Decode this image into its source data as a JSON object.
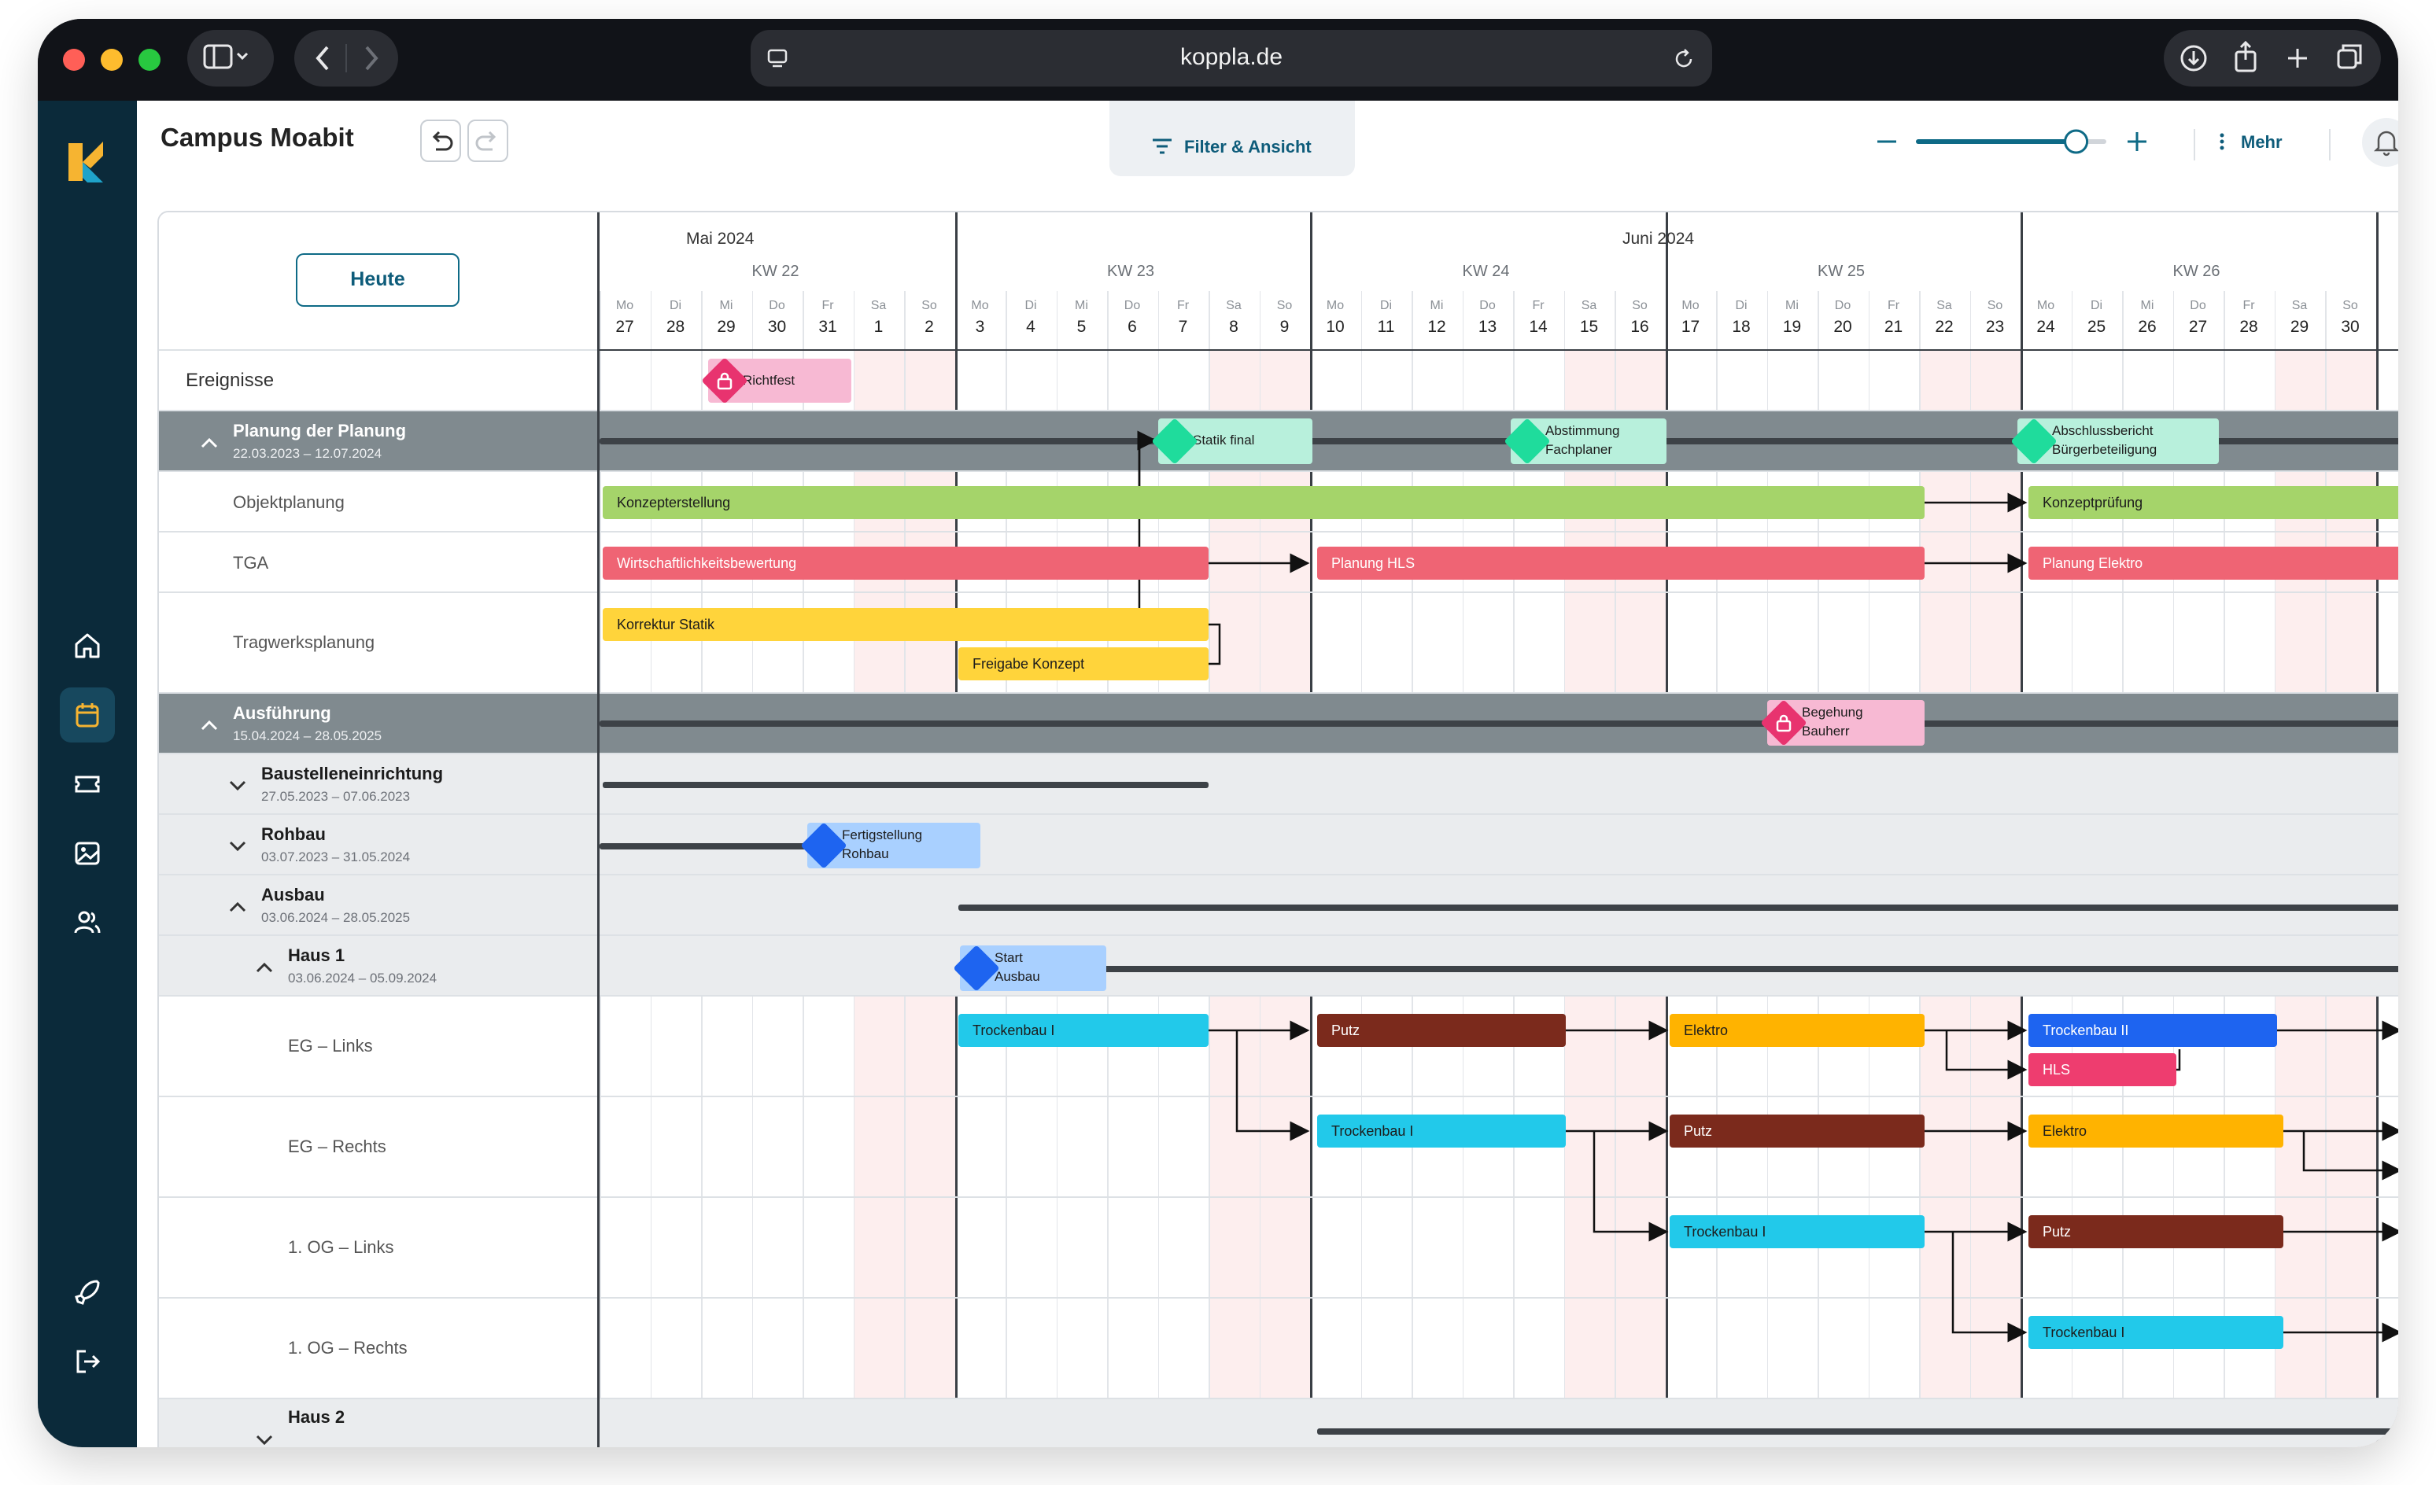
{
  "browser": {
    "url": "koppla.de"
  },
  "header": {
    "title": "Campus Moabit",
    "filter_label": "Filter & Ansicht",
    "more_label": "Mehr"
  },
  "board": {
    "today_label": "Heute",
    "months": [
      "Mai 2024",
      "Juni 2024"
    ],
    "weeks": [
      "KW 22",
      "KW 23",
      "KW 24",
      "KW 25",
      "KW 26"
    ],
    "days": [
      {
        "dow": "Mo",
        "num": "27"
      },
      {
        "dow": "Di",
        "num": "28"
      },
      {
        "dow": "Mi",
        "num": "29"
      },
      {
        "dow": "Do",
        "num": "30"
      },
      {
        "dow": "Fr",
        "num": "31"
      },
      {
        "dow": "Sa",
        "num": "1"
      },
      {
        "dow": "So",
        "num": "2"
      },
      {
        "dow": "Mo",
        "num": "3"
      },
      {
        "dow": "Di",
        "num": "4"
      },
      {
        "dow": "Mi",
        "num": "5"
      },
      {
        "dow": "Do",
        "num": "6"
      },
      {
        "dow": "Fr",
        "num": "7"
      },
      {
        "dow": "Sa",
        "num": "8"
      },
      {
        "dow": "So",
        "num": "9"
      },
      {
        "dow": "Mo",
        "num": "10"
      },
      {
        "dow": "Di",
        "num": "11"
      },
      {
        "dow": "Mi",
        "num": "12"
      },
      {
        "dow": "Do",
        "num": "13"
      },
      {
        "dow": "Fr",
        "num": "14"
      },
      {
        "dow": "Sa",
        "num": "15"
      },
      {
        "dow": "So",
        "num": "16"
      },
      {
        "dow": "Mo",
        "num": "17"
      },
      {
        "dow": "Di",
        "num": "18"
      },
      {
        "dow": "Mi",
        "num": "19"
      },
      {
        "dow": "Do",
        "num": "20"
      },
      {
        "dow": "Fr",
        "num": "21"
      },
      {
        "dow": "Sa",
        "num": "22"
      },
      {
        "dow": "So",
        "num": "23"
      },
      {
        "dow": "Mo",
        "num": "24"
      },
      {
        "dow": "Di",
        "num": "25"
      },
      {
        "dow": "Mi",
        "num": "26"
      },
      {
        "dow": "Do",
        "num": "27"
      },
      {
        "dow": "Fr",
        "num": "28"
      },
      {
        "dow": "Sa",
        "num": "29"
      },
      {
        "dow": "So",
        "num": "30"
      }
    ],
    "rows": {
      "events": "Ereignisse",
      "planung": {
        "title": "Planung der Planung",
        "dates": "22.03.2023 – 12.07.2024"
      },
      "objektplanung": "Objektplanung",
      "tga": "TGA",
      "tragwerk": "Tragwerksplanung",
      "ausfuehrung": {
        "title": "Ausführung",
        "dates": "15.04.2024 – 28.05.2025"
      },
      "baustelle": {
        "title": "Baustelleneinrichtung",
        "dates": "27.05.2023 – 07.06.2023"
      },
      "rohbau": {
        "title": "Rohbau",
        "dates": "03.07.2023 – 31.05.2024"
      },
      "ausbau": {
        "title": "Ausbau",
        "dates": "03.06.2024 – 28.05.2025"
      },
      "haus1": {
        "title": "Haus 1",
        "dates": "03.06.2024 – 05.09.2024"
      },
      "eg_links": "EG – Links",
      "eg_rechts": "EG – Rechts",
      "og_links": "1. OG – Links",
      "og_rechts": "1. OG – Rechts",
      "haus2": {
        "title": "Haus 2"
      }
    },
    "milestones": {
      "richtfest": "Richtfest",
      "statik_final": "Statik final",
      "abstimmung": [
        "Abstimmung",
        "Fachplaner"
      ],
      "abschluss": [
        "Abschlussbericht",
        "Bürgerbeteiligung"
      ],
      "begehung": [
        "Begehung",
        "Bauherr"
      ],
      "fertig_rohbau": [
        "Fertigstellung",
        "Rohbau"
      ],
      "start_ausbau": [
        "Start",
        "Ausbau"
      ]
    },
    "tasks": {
      "konzepterstellung": "Konzepterstellung",
      "konzeptpruefung": "Konzeptprüfung",
      "wirtschaft": "Wirtschaftlichkeitsbewertung",
      "planung_hls": "Planung HLS",
      "planung_elektro": "Planung Elektro",
      "korrektur_statik": "Korrektur Statik",
      "freigabe_konzept": "Freigabe Konzept",
      "trockenbau_1": "Trockenbau I",
      "trockenbau_2": "Trockenbau II",
      "putz": "Putz",
      "elektro": "Elektro",
      "hls": "HLS"
    },
    "colors": {
      "sidebar": "#0b2a3a",
      "accent": "#0e6a86",
      "green": "#a5d46a",
      "red": "#ef6474",
      "yellow": "#ffd43b",
      "cyan": "#22c9ea",
      "brown": "#7b2a1c",
      "orange": "#ffb300",
      "blue": "#1e64f0",
      "pink": "#e8336f",
      "teal_milestone": "#1fdc9c"
    }
  },
  "zoom": {
    "level": 0.85
  }
}
